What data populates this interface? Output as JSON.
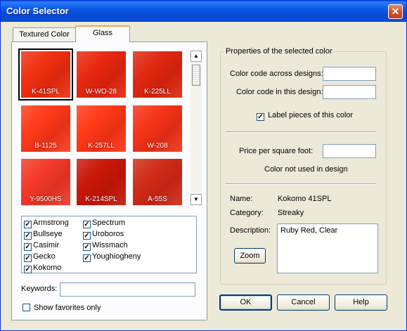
{
  "window": {
    "title": "Color Selector",
    "close_symbol": "✕"
  },
  "tabs": [
    {
      "label": "Textured Color"
    },
    {
      "label": "Glass"
    }
  ],
  "swatches": [
    {
      "code": "K-41SPL",
      "color": "#f03010",
      "selected": true
    },
    {
      "code": "W-WO-28",
      "color": "#e82810"
    },
    {
      "code": "K-225LL",
      "color": "#e02810"
    },
    {
      "code": "B-1125",
      "color": "#ff3b1a"
    },
    {
      "code": "K-257LL",
      "color": "#ff3a18"
    },
    {
      "code": "W-208",
      "color": "#f53418"
    },
    {
      "code": "Y-9500HS",
      "color": "#f43a28"
    },
    {
      "code": "K-214SPL",
      "color": "#c81808"
    },
    {
      "code": "A-55S",
      "color": "#d02c18"
    }
  ],
  "manufacturers": [
    {
      "label": "Armstrong",
      "checked": true
    },
    {
      "label": "Bullseye",
      "checked": true
    },
    {
      "label": "Casimir",
      "checked": true
    },
    {
      "label": "Gecko",
      "checked": true
    },
    {
      "label": "Kokomo",
      "checked": true
    },
    {
      "label": "Spectrum",
      "checked": true
    },
    {
      "label": "Uroboros",
      "checked": true
    },
    {
      "label": "Wissmach",
      "checked": true
    },
    {
      "label": "Youghiogheny",
      "checked": true
    }
  ],
  "keywords": {
    "label": "Keywords:",
    "value": ""
  },
  "show_favorites": {
    "label": "Show favorites only",
    "checked": false
  },
  "properties": {
    "group_title": "Properties of the selected color",
    "code_across_label": "Color code across designs:",
    "code_across_value": "",
    "code_in_design_label": "Color code in this design:",
    "code_in_design_value": "",
    "label_pieces": {
      "label": "Label pieces of this color",
      "checked": true
    },
    "price_label": "Price per square foot:",
    "price_value": "",
    "usage_status": "Color not used in design",
    "name_label": "Name:",
    "name_value": "Kokomo 41SPL",
    "category_label": "Category:",
    "category_value": "Streaky",
    "description_label": "Description:",
    "description_value": "Ruby Red, Clear",
    "zoom_label": "Zoom"
  },
  "buttons": {
    "ok": "OK",
    "cancel": "Cancel",
    "help": "Help"
  },
  "scroll": {
    "up": "▲",
    "down": "▼"
  }
}
